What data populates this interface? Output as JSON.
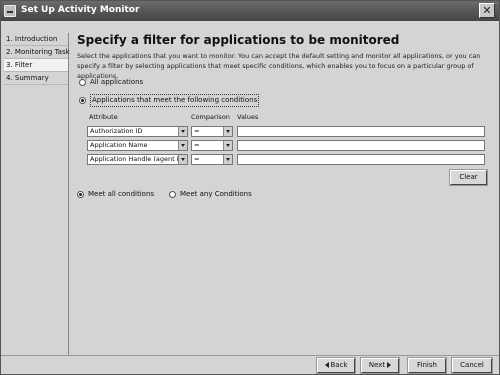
{
  "window": {
    "title": "Set Up Activity Monitor",
    "close_glyph": "✕"
  },
  "steps": [
    {
      "label": "1. Introduction",
      "active": false
    },
    {
      "label": "2. Monitoring Task",
      "active": false
    },
    {
      "label": "3. Filter",
      "active": true
    },
    {
      "label": "4. Summary",
      "active": false
    }
  ],
  "main": {
    "heading": "Specify a filter for applications to be monitored",
    "description": "Select the applications that you want to monitor. You can accept the default setting and monitor all applications, or you can specify a filter by selecting applications that meet specific conditions, which enables you to focus on a particular group of applications.",
    "scope_options": [
      {
        "label": "All applications",
        "selected": false
      },
      {
        "label": "Applications that meet the following conditions",
        "selected": true
      }
    ],
    "columns": {
      "attribute": "Attribute",
      "comparison": "Comparison",
      "values": "Values"
    },
    "conditions": [
      {
        "attribute": "Authorization ID",
        "comparison": "=",
        "value": ""
      },
      {
        "attribute": "Application Name",
        "comparison": "=",
        "value": ""
      },
      {
        "attribute": "Application Handle (agent ID)",
        "comparison": "=",
        "value": ""
      }
    ],
    "clear_label": "Clear",
    "match_options": [
      {
        "label": "Meet all conditions",
        "selected": true
      },
      {
        "label": "Meet any Conditions",
        "selected": false
      }
    ]
  },
  "footer": {
    "back_label": "Back",
    "next_label": "Next",
    "finish_label": "Finish",
    "cancel_label": "Cancel"
  }
}
